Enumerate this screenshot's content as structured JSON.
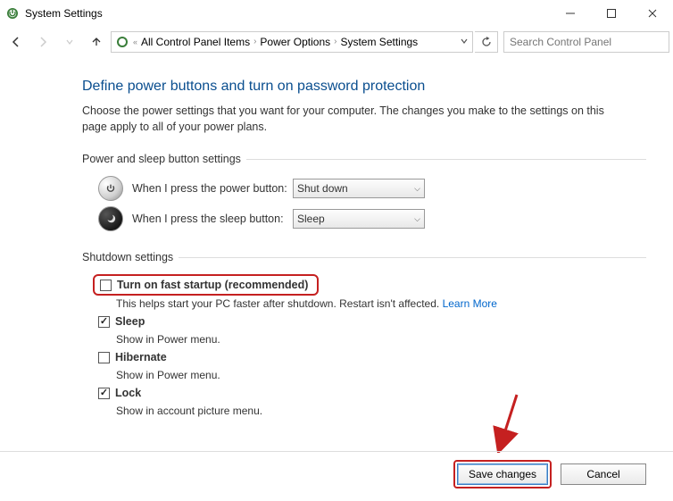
{
  "window": {
    "title": "System Settings"
  },
  "breadcrumb": {
    "item1": "All Control Panel Items",
    "item2": "Power Options",
    "item3": "System Settings"
  },
  "search": {
    "placeholder": "Search Control Panel"
  },
  "page": {
    "heading": "Define power buttons and turn on password protection",
    "intro": "Choose the power settings that you want for your computer. The changes you make to the settings on this page apply to all of your power plans."
  },
  "section1": {
    "title": "Power and sleep button settings",
    "power_label": "When I press the power button:",
    "power_value": "Shut down",
    "sleep_label": "When I press the sleep button:",
    "sleep_value": "Sleep"
  },
  "section2": {
    "title": "Shutdown settings",
    "fast": {
      "label": "Turn on fast startup (recommended)",
      "sub": "This helps start your PC faster after shutdown. Restart isn't affected. ",
      "link": "Learn More"
    },
    "sleep": {
      "label": "Sleep",
      "sub": "Show in Power menu."
    },
    "hibernate": {
      "label": "Hibernate",
      "sub": "Show in Power menu."
    },
    "lock": {
      "label": "Lock",
      "sub": "Show in account picture menu."
    }
  },
  "footer": {
    "save": "Save changes",
    "cancel": "Cancel"
  }
}
